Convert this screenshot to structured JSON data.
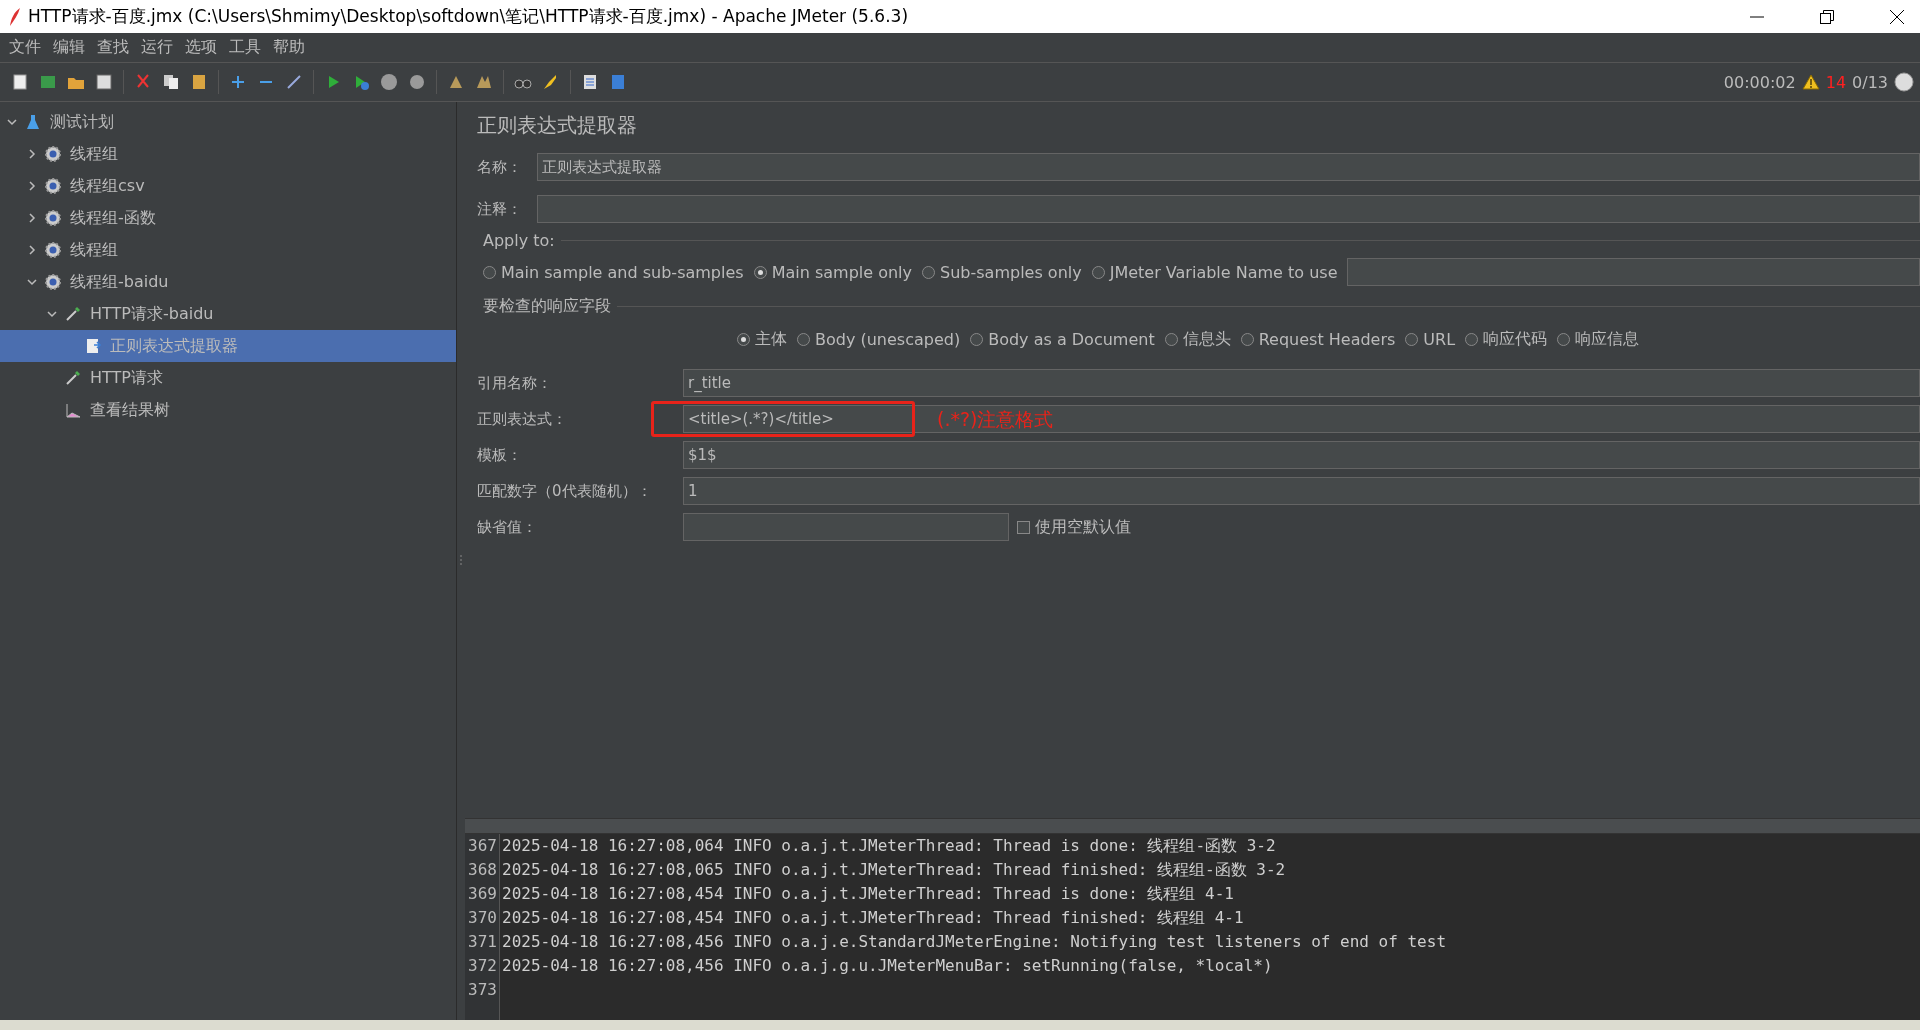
{
  "window": {
    "title": "HTTP请求-百度.jmx (C:\\Users\\Shmimy\\Desktop\\softdown\\笔记\\HTTP请求-百度.jmx) - Apache JMeter (5.6.3)"
  },
  "menu": [
    "文件",
    "编辑",
    "查找",
    "运行",
    "选项",
    "工具",
    "帮助"
  ],
  "status": {
    "timer": "00:00:02",
    "warnings": "14",
    "threads": "0/13"
  },
  "tree": [
    {
      "label": "测试计划",
      "kind": "plan",
      "expanded": true,
      "selected": false,
      "children": [
        {
          "label": "线程组",
          "kind": "group",
          "expanded": false,
          "selected": false
        },
        {
          "label": "线程组csv",
          "kind": "group",
          "expanded": false,
          "selected": false
        },
        {
          "label": "线程组-函数",
          "kind": "group",
          "expanded": false,
          "selected": false
        },
        {
          "label": "线程组",
          "kind": "group",
          "expanded": false,
          "selected": false
        },
        {
          "label": "线程组-baidu",
          "kind": "group",
          "expanded": true,
          "selected": false,
          "children": [
            {
              "label": "HTTP请求-baidu",
              "kind": "sampler",
              "expanded": true,
              "selected": false,
              "children": [
                {
                  "label": "正则表达式提取器",
                  "kind": "extractor",
                  "selected": true
                }
              ]
            },
            {
              "label": "HTTP请求",
              "kind": "sampler",
              "selected": false
            },
            {
              "label": "查看结果树",
              "kind": "listener",
              "selected": false
            }
          ]
        }
      ]
    }
  ],
  "panel": {
    "title": "正则表达式提取器",
    "name_label": "名称：",
    "name_value": "正则表达式提取器",
    "comment_label": "注释：",
    "apply_to": {
      "legend": "Apply to:",
      "options": [
        {
          "label": "Main sample and sub-samples",
          "selected": false
        },
        {
          "label": "Main sample only",
          "selected": true
        },
        {
          "label": "Sub-samples only",
          "selected": false
        },
        {
          "label": "JMeter Variable Name to use",
          "selected": false
        }
      ]
    },
    "fields": {
      "legend": "要检查的响应字段",
      "options": [
        {
          "label": "主体",
          "selected": true
        },
        {
          "label": "Body (unescaped)",
          "selected": false
        },
        {
          "label": "Body as a Document",
          "selected": false
        },
        {
          "label": "信息头",
          "selected": false
        },
        {
          "label": "Request Headers",
          "selected": false
        },
        {
          "label": "URL",
          "selected": false
        },
        {
          "label": "响应代码",
          "selected": false
        },
        {
          "label": "响应信息",
          "selected": false
        }
      ]
    },
    "rows": [
      {
        "label": "引用名称：",
        "kind": "wide",
        "value": "r_title"
      },
      {
        "label": "正则表达式：",
        "kind": "wide",
        "value": "<title>(.*?)</title>",
        "highlighted": true,
        "annotation": "(.*?)注意格式"
      },
      {
        "label": "模板：",
        "kind": "wide",
        "value": "$1$"
      },
      {
        "label": "匹配数字（0代表随机）：",
        "kind": "wide",
        "value": "1"
      },
      {
        "label": "缺省值：",
        "kind": "short",
        "checkbox": {
          "label": "使用空默认值",
          "checked": false
        }
      }
    ]
  },
  "log": [
    {
      "line": "367",
      "text": "2025-04-18 16:27:08,064 INFO o.a.j.t.JMeterThread: Thread is done: 线程组-函数 3-2"
    },
    {
      "line": "368",
      "text": "2025-04-18 16:27:08,065 INFO o.a.j.t.JMeterThread: Thread finished: 线程组-函数 3-2"
    },
    {
      "line": "369",
      "text": "2025-04-18 16:27:08,454 INFO o.a.j.t.JMeterThread: Thread is done: 线程组 4-1"
    },
    {
      "line": "370",
      "text": "2025-04-18 16:27:08,454 INFO o.a.j.t.JMeterThread: Thread finished: 线程组 4-1"
    },
    {
      "line": "371",
      "text": "2025-04-18 16:27:08,456 INFO o.a.j.e.StandardJMeterEngine: Notifying test listeners of end of test"
    },
    {
      "line": "372",
      "text": "2025-04-18 16:27:08,456 INFO o.a.j.g.u.JMeterMenuBar: setRunning(false, *local*)"
    },
    {
      "line": "373"
    }
  ]
}
